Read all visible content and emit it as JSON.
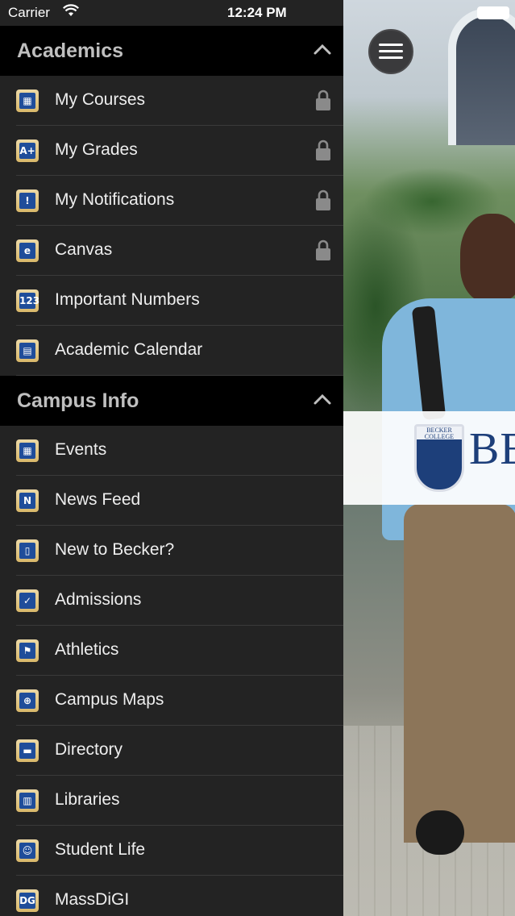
{
  "status_bar": {
    "carrier": "Carrier",
    "time": "12:24 PM"
  },
  "hero": {
    "crest_text": "BECKER COLLEGE",
    "wordmark": "BE"
  },
  "menu": {
    "icon": "hamburger-menu-icon"
  },
  "sections": [
    {
      "title": "Academics",
      "items": [
        {
          "label": "My Courses",
          "icon": "courses-icon",
          "glyph": "▦",
          "locked": true
        },
        {
          "label": "My Grades",
          "icon": "grades-icon",
          "glyph": "A+",
          "locked": true
        },
        {
          "label": "My Notifications",
          "icon": "notifications-icon",
          "glyph": "!",
          "locked": true
        },
        {
          "label": "Canvas",
          "icon": "canvas-icon",
          "glyph": "e",
          "locked": true
        },
        {
          "label": "Important Numbers",
          "icon": "important-numbers-icon",
          "glyph": "123",
          "locked": false
        },
        {
          "label": "Academic Calendar",
          "icon": "calendar-icon",
          "glyph": "▤",
          "locked": false
        }
      ]
    },
    {
      "title": "Campus Info",
      "items": [
        {
          "label": "Events",
          "icon": "events-icon",
          "glyph": "▦",
          "locked": false
        },
        {
          "label": "News Feed",
          "icon": "news-icon",
          "glyph": "N",
          "locked": false
        },
        {
          "label": "New to Becker?",
          "icon": "door-icon",
          "glyph": "▯",
          "locked": false
        },
        {
          "label": "Admissions",
          "icon": "checkbox-icon",
          "glyph": "✓",
          "locked": false
        },
        {
          "label": "Athletics",
          "icon": "athletics-icon",
          "glyph": "⚑",
          "locked": false
        },
        {
          "label": "Campus Maps",
          "icon": "map-icon",
          "glyph": "⊕",
          "locked": false
        },
        {
          "label": "Directory",
          "icon": "directory-icon",
          "glyph": "▬",
          "locked": false
        },
        {
          "label": "Libraries",
          "icon": "library-icon",
          "glyph": "▥",
          "locked": false
        },
        {
          "label": "Student Life",
          "icon": "student-life-icon",
          "glyph": "☺",
          "locked": false
        },
        {
          "label": "MassDiGI",
          "icon": "massdigi-icon",
          "glyph": "DG",
          "locked": false
        }
      ]
    }
  ],
  "colors": {
    "drawer_bg": "#232323",
    "header_bg": "#000000",
    "icon_blue": "#1f4d9a",
    "icon_tan": "#d9b86a"
  }
}
